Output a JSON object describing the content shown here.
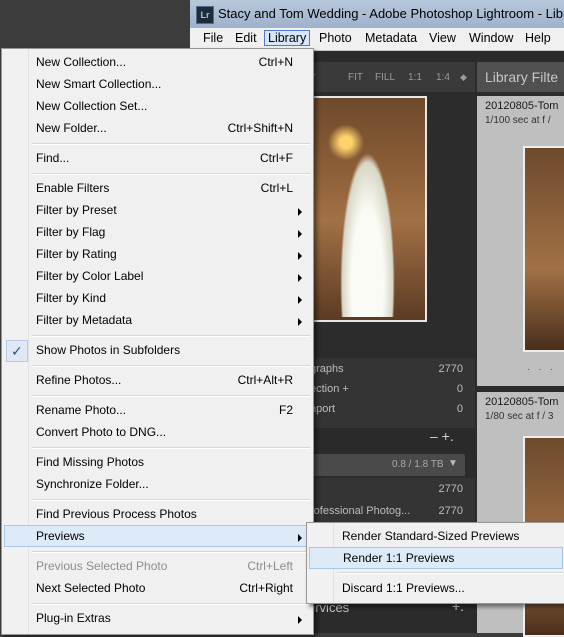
{
  "window": {
    "app_icon": "Lr",
    "title": "Stacy and Tom Wedding - Adobe Photoshop Lightroom - Library"
  },
  "menubar": [
    "File",
    "Edit",
    "Library",
    "Photo",
    "Metadata",
    "View",
    "Window",
    "Help"
  ],
  "menubar_active": "Library",
  "navigator": {
    "header_letter": "r",
    "zoom_options": [
      "FIT",
      "FILL",
      "1:1",
      "1:4"
    ]
  },
  "catalog_stats": [
    {
      "label": "graphs",
      "value": "2770"
    },
    {
      "label": "ection  +",
      "value": "0"
    },
    {
      "label": "nport",
      "value": "0"
    }
  ],
  "folders": {
    "controls": "–  +.",
    "drive_label": "0.8 / 1.8 TB",
    "rows": [
      {
        "label": "",
        "value": "2770"
      },
      {
        "label": "rofessional Photog...",
        "value": "2770"
      }
    ],
    "services_label": "ervices",
    "services_plus": "+."
  },
  "grid": {
    "filter_title": "Library Filte",
    "cells": [
      {
        "title": "20120805-Tom",
        "sub": "1/100 sec at f /"
      },
      {
        "title": "20120805-Tom",
        "sub": "1/80 sec at f / 3"
      }
    ]
  },
  "library_menu": {
    "items": [
      {
        "label": "New Collection...",
        "shortcut": "Ctrl+N"
      },
      {
        "label": "New Smart Collection...",
        "shortcut": ""
      },
      {
        "label": "New Collection Set...",
        "shortcut": ""
      },
      {
        "label": "New Folder...",
        "shortcut": "Ctrl+Shift+N"
      },
      {
        "label": "Find...",
        "shortcut": "Ctrl+F"
      },
      {
        "label": "Enable Filters",
        "shortcut": "Ctrl+L"
      },
      {
        "label": "Filter by Preset",
        "submenu": true
      },
      {
        "label": "Filter by Flag",
        "submenu": true
      },
      {
        "label": "Filter by Rating",
        "submenu": true
      },
      {
        "label": "Filter by Color Label",
        "submenu": true
      },
      {
        "label": "Filter by Kind",
        "submenu": true
      },
      {
        "label": "Filter by Metadata",
        "submenu": true
      },
      {
        "label": "Show Photos in Subfolders",
        "checked": true
      },
      {
        "label": "Refine Photos...",
        "shortcut": "Ctrl+Alt+R"
      },
      {
        "label": "Rename Photo...",
        "shortcut": "F2"
      },
      {
        "label": "Convert Photo to DNG...",
        "shortcut": ""
      },
      {
        "label": "Find Missing Photos",
        "shortcut": ""
      },
      {
        "label": "Synchronize Folder...",
        "shortcut": ""
      },
      {
        "label": "Find Previous Process Photos",
        "shortcut": ""
      },
      {
        "label": "Previews",
        "submenu": true,
        "highlighted": true
      },
      {
        "label": "Previous Selected Photo",
        "shortcut": "Ctrl+Left",
        "disabled": true
      },
      {
        "label": "Next Selected Photo",
        "shortcut": "Ctrl+Right"
      },
      {
        "label": "Plug-in Extras",
        "submenu": true
      }
    ]
  },
  "previews_submenu": {
    "items": [
      {
        "label": "Render Standard-Sized Previews"
      },
      {
        "label": "Render 1:1 Previews",
        "highlighted": true
      },
      {
        "label": "Discard 1:1 Previews..."
      }
    ]
  },
  "colors": {
    "menu_bg": "#f0f0f0",
    "highlight_bg": "#ddeaf8",
    "highlight_border": "#a9c7ea",
    "lightroom_bg": "#2b2b2b"
  }
}
